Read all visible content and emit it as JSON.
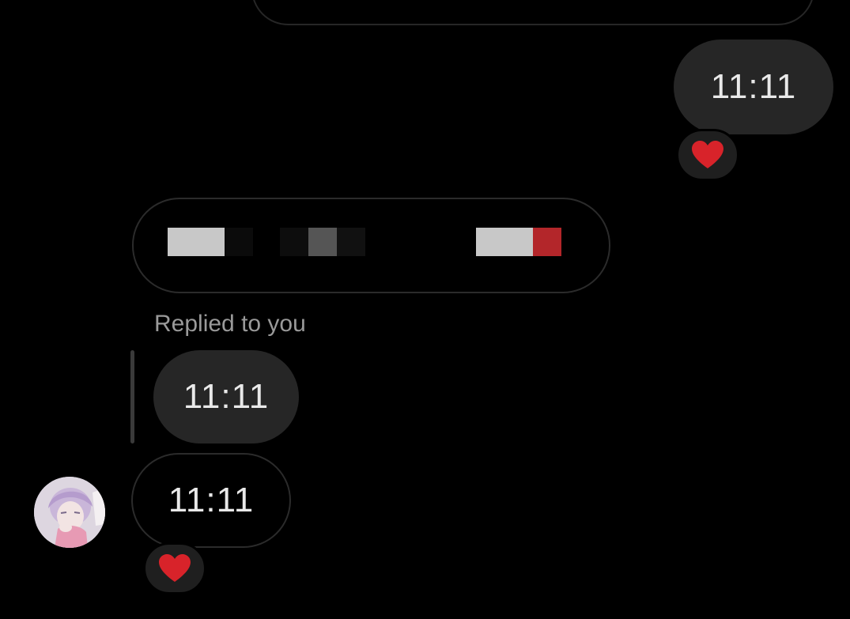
{
  "thread": {
    "outgoing_message_1": {
      "text": "11:11",
      "reaction": "heart-icon"
    },
    "incoming_redacted_message": {
      "text": ""
    },
    "reply_context": {
      "label": "Replied to you",
      "quoted_text": "11:11"
    },
    "incoming_message_2": {
      "text": "11:11",
      "reaction": "heart-icon"
    }
  },
  "colors": {
    "background": "#000000",
    "bubble_fill": "#262626",
    "bubble_outline": "#2b2b2b",
    "reaction_heart": "#d8232a",
    "muted_text": "#9a9a9a"
  }
}
